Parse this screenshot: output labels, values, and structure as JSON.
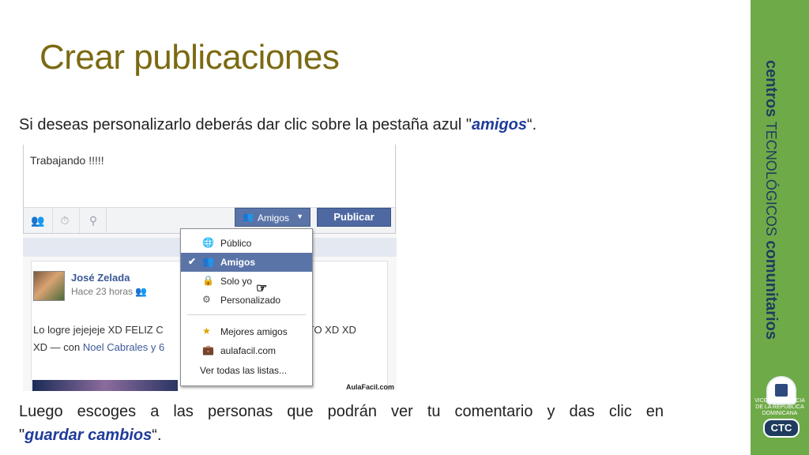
{
  "slide": {
    "title": "Crear publicaciones",
    "intro_prefix": "Si deseas personalizarlo deberás dar clic sobre la pestaña azul \"",
    "intro_emphasis": "amigos",
    "intro_suffix": "“.",
    "outro_words_line1": [
      "Luego",
      "escoges",
      "a",
      "las",
      "personas",
      "que",
      "podrán",
      "ver",
      "tu",
      "comentario",
      "y",
      "das",
      "clic",
      "en"
    ],
    "outro_prefix": "\"",
    "outro_emphasis": "guardar cambios",
    "outro_suffix": "“."
  },
  "composer": {
    "text": "Trabajando !!!!!",
    "audience_button": "Amigos",
    "publish_button": "Publicar"
  },
  "audience_menu": {
    "items": [
      {
        "label": "Público",
        "icon": "globe-icon"
      },
      {
        "label": "Amigos",
        "icon": "friends-icon",
        "selected": true
      },
      {
        "label": "Solo yo",
        "icon": "lock-icon"
      },
      {
        "label": "Personalizado",
        "icon": "gear-icon"
      },
      {
        "label": "Mejores amigos",
        "icon": "star-icon"
      },
      {
        "label": "aulafacil.com",
        "icon": "briefcase-icon"
      }
    ],
    "see_all": "Ver todas las listas..."
  },
  "post": {
    "author": "José Zelada",
    "time": "Hace 23 horas",
    "line1": "Lo logre jejejeje XD FELIZ C",
    "line1_end": "NITO XD XD",
    "line2_prefix": "XD — con",
    "line2_link": "Noel Cabrales y 6"
  },
  "watermark": "AulaFacil.com",
  "brand": {
    "word1": "centros",
    "word2": "TECNOLÓGICOS",
    "word3": "comunitarios",
    "vp_text": "VICEPRESIDENCIA DE LA REPÚBLICA DOMINICANA",
    "ctc": "CTC"
  },
  "colors": {
    "title": "#7b6a12",
    "emphasis": "#1f3b9a",
    "band": "#6faa48",
    "fb_button": "#5b74a8"
  }
}
